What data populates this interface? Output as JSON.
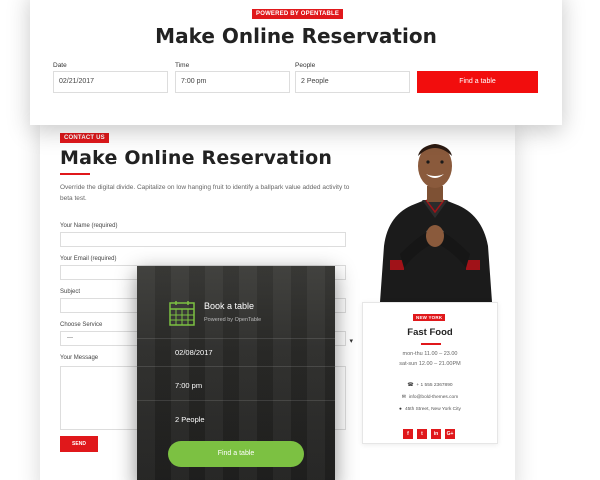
{
  "top_bar": {
    "badge": "POWERED BY OPENTABLE",
    "title": "Make Online Reservation",
    "date_label": "Date",
    "date_value": "02/21/2017",
    "time_label": "Time",
    "time_value": "7:00 pm",
    "people_label": "People",
    "people_value": "2 People",
    "find_button": "Find a table"
  },
  "contact": {
    "badge": "CONTACT US",
    "title": "Make Online Reservation",
    "description": "Override the digital divide. Capitalize on low hanging fruit to identify a ballpark value added activity to beta test.",
    "name_label": "Your Name (required)",
    "email_label": "Your Email (required)",
    "subject_label": "Subject",
    "service_label": "Choose Service",
    "service_value": "---",
    "message_label": "Your Message",
    "send_button": "SEND"
  },
  "venue": {
    "badge": "New York",
    "name": "Fast Food",
    "hours_1": "mon-thu 11.00 – 23.00",
    "hours_2": "sat-sun 12.00 – 21.00PM",
    "phone": "+ 1 555 2367890",
    "email": "info@bold-themes.com",
    "address": "45th Street, New York City",
    "social": [
      "f",
      "t",
      "in",
      "G+"
    ]
  },
  "widget": {
    "title": "Book a table",
    "subtitle": "Powered by OpenTable",
    "date_value": "02/08/2017",
    "time_value": "7:00 pm",
    "people_value": "2 People",
    "find_button": "Find a table"
  },
  "colors": {
    "accent_red": "#e0181b",
    "button_green": "#7cc142",
    "widget_dark": "#2a2a28"
  }
}
